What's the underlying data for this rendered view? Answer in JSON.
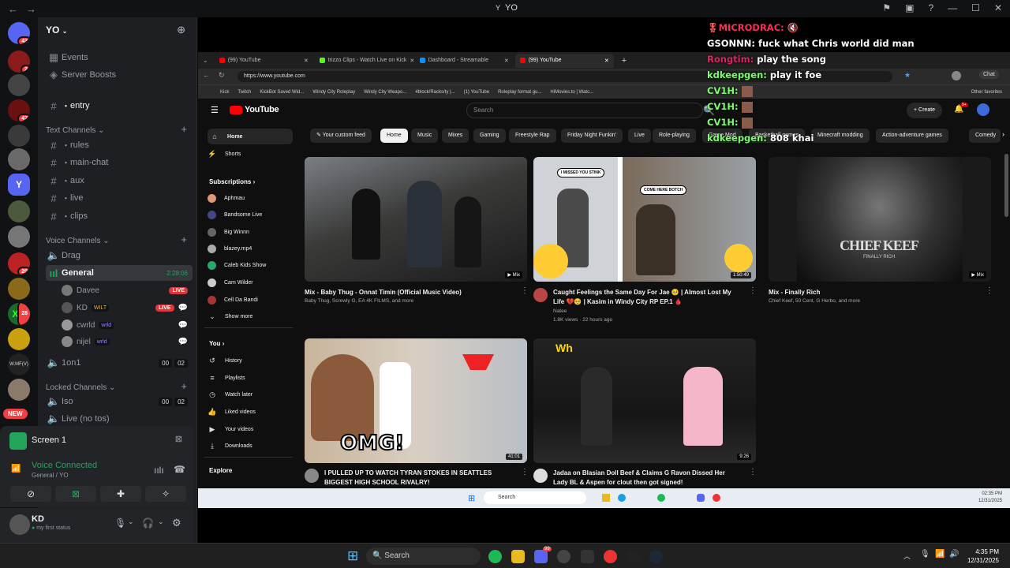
{
  "window": {
    "title": "YO"
  },
  "server": {
    "name": "YO"
  },
  "rail_badges": [
    "43",
    "2",
    "47",
    "20",
    "28"
  ],
  "rail_new": "NEW",
  "menu": {
    "events": "Events",
    "boosts": "Server Boosts",
    "entry": "entry"
  },
  "text_category": "Text Channels",
  "text_channels": [
    "rules",
    "main-chat",
    "aux",
    "live",
    "clips"
  ],
  "voice_category": "Voice Channels",
  "voice": {
    "drag": "Drag",
    "general": "General",
    "general_time": "2:28:06",
    "onev1": "1on1",
    "onev1_a": "00",
    "onev1_b": "02"
  },
  "voice_users": [
    {
      "name": "Davee",
      "live": "LIVE"
    },
    {
      "name": "KD",
      "tag": "WILT",
      "live": "LIVE"
    },
    {
      "name": "cwrld",
      "tag": "wrld"
    },
    {
      "name": "nijel",
      "tag": "wrld"
    }
  ],
  "locked_category": "Locked Channels",
  "locked": {
    "iso": "Iso",
    "iso_a": "00",
    "iso_b": "02",
    "live_no_tos": "Live (no tos)"
  },
  "screen_panel": {
    "title": "Screen 1",
    "status": "Voice Connected",
    "sub": "General / YO"
  },
  "user": {
    "name": "KD",
    "status": "my first status"
  },
  "browser": {
    "tabs": [
      {
        "label": "(99) YouTube",
        "color": "#ff0000"
      },
      {
        "label": "trizzo Clips - Watch Live on Kick",
        "color": "#53fc18"
      },
      {
        "label": "Dashboard - Streamable",
        "color": "#0f90fa"
      },
      {
        "label": "(99) YouTube",
        "color": "#ff0000"
      }
    ],
    "url": "https://www.youtube.com",
    "bookmarks": [
      "Kick",
      "Twitch",
      "KickBot Saved Wid...",
      "Windy City Roleplay",
      "Windy City Weapo...",
      "4block/Racks/ty |...",
      "(1) YouTube",
      "Roleplay format gu...",
      "HiMovies.to | Watc...",
      "Other favorites"
    ]
  },
  "youtube": {
    "logo": "YouTube",
    "search_placeholder": "Search",
    "create": "Create",
    "notif": "9+",
    "side_main": [
      "Home",
      "Shorts"
    ],
    "subs_header": "Subscriptions",
    "subs": [
      "Aphmau",
      "Bandsome Live",
      "Big Winnn",
      "blazey.mp4",
      "Caleb Kids Show",
      "Cam Wilder",
      "Cell Da Bandi"
    ],
    "show_more": "Show more",
    "you_header": "You",
    "you": [
      "History",
      "Playlists",
      "Watch later",
      "Liked videos",
      "Your videos",
      "Downloads"
    ],
    "explore": "Explore",
    "chips": [
      "Your custom feed",
      "Home",
      "Music",
      "Mixes",
      "Gaming",
      "Freestyle Rap",
      "Friday Night Funkin'",
      "Live",
      "Role-playing",
      "Game Mod",
      "Basketball games",
      "Minecraft modding",
      "Action-adventure games",
      "Comedy"
    ],
    "videos": [
      {
        "title": "Mix - Baby Thug - Onnat Timin (Official Music Video)",
        "meta": "Baby Thug, Screwly G, EA 4K FILMS, and more",
        "meta2": "",
        "badge": "Mix"
      },
      {
        "title": "Caught Feelings the Same Day For Jae 🥺 | Almost Lost My Life 💔🥺 | Kasim in Windy City RP EP.1 🩸",
        "meta": "Natee",
        "meta2": "1.8K views · 22 hours ago",
        "badge": "1:50:49"
      },
      {
        "title": "Mix - Finally Rich",
        "meta": "Chief Keef, 50 Cent, G Herbo, and more",
        "meta2": "",
        "badge": "Mix"
      },
      {
        "title": "I PULLED UP TO WATCH TYRAN STOKES IN SEATTLES BIGGEST HIGH SCHOOL RIVALRY!",
        "meta": "",
        "meta2": "",
        "badge": "41:01"
      },
      {
        "title": "Jadaa on Blasian Doll Beef & Claims G Ravon Dissed Her Lady BL & Aspen for clout then got signed!",
        "meta": "",
        "meta2": "",
        "badge": "9:26"
      }
    ],
    "thumb_text": {
      "omg": "OMG!",
      "keef": "CHIEF KEEF",
      "keef_sub": "FINALLY RICH",
      "bubble1": "I MISSED YOU STINK",
      "bubble2": "COME HERE BOTCH"
    }
  },
  "inner_taskbar": {
    "search": "Search",
    "time": "02:35 PM",
    "date": "12/31/2025"
  },
  "chat": [
    {
      "user": "MICRODRAC:",
      "msg": "",
      "color": "#ff2d55"
    },
    {
      "user": "GSONNN:",
      "msg": "fuck what Chris world did man",
      "color": "#ffffff"
    },
    {
      "user": "Rongtim:",
      "msg": "play the song",
      "color": "#e0245e"
    },
    {
      "user": "kdkeepgen:",
      "msg": "play it foe",
      "color": "#7dff6b"
    },
    {
      "user": "CV1H:",
      "msg": "",
      "color": "#7dff6b"
    },
    {
      "user": "CV1H:",
      "msg": "",
      "color": "#7dff6b"
    },
    {
      "user": "CV1H:",
      "msg": "",
      "color": "#7dff6b"
    },
    {
      "user": "kdkeepgen:",
      "msg": "808 khai",
      "color": "#7dff6b"
    }
  ],
  "taskbar": {
    "search": "Search",
    "time": "4:35 PM",
    "date": "12/31/2025",
    "discord_badge": "99"
  }
}
